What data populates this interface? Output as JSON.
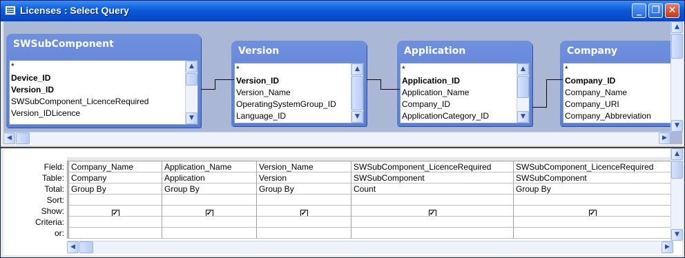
{
  "window": {
    "title": "Licenses : Select Query",
    "minimize": "_",
    "restore": "❐",
    "close": "✕"
  },
  "tables": [
    {
      "name": "SWSubComponent",
      "fields": [
        {
          "label": "*",
          "key": false
        },
        {
          "label": "Device_ID",
          "key": true
        },
        {
          "label": "Version_ID",
          "key": true
        },
        {
          "label": "SWSubComponent_LicenceRequired",
          "key": false
        },
        {
          "label": "Version_IDLicence",
          "key": false
        }
      ]
    },
    {
      "name": "Version",
      "fields": [
        {
          "label": "*",
          "key": false
        },
        {
          "label": "Version_ID",
          "key": true
        },
        {
          "label": "Version_Name",
          "key": false
        },
        {
          "label": "OperatingSystemGroup_ID",
          "key": false
        },
        {
          "label": "Language_ID",
          "key": false
        }
      ]
    },
    {
      "name": "Application",
      "fields": [
        {
          "label": "*",
          "key": false
        },
        {
          "label": "Application_ID",
          "key": true
        },
        {
          "label": "Application_Name",
          "key": false
        },
        {
          "label": "Company_ID",
          "key": false
        },
        {
          "label": "ApplicationCategory_ID",
          "key": false
        }
      ]
    },
    {
      "name": "Company",
      "fields": [
        {
          "label": "*",
          "key": false
        },
        {
          "label": "Company_ID",
          "key": true
        },
        {
          "label": "Company_Name",
          "key": false
        },
        {
          "label": "Company_URI",
          "key": false
        },
        {
          "label": "Company_Abbreviation",
          "key": false
        }
      ]
    }
  ],
  "grid": {
    "row_labels": [
      "Field:",
      "Table:",
      "Total:",
      "Sort:",
      "Show:",
      "Criteria:",
      "or:"
    ],
    "columns": [
      {
        "field": "Company_Name",
        "table": "Company",
        "total": "Group By",
        "sort": "",
        "show": true
      },
      {
        "field": "Application_Name",
        "table": "Application",
        "total": "Group By",
        "sort": "",
        "show": true
      },
      {
        "field": "Version_Name",
        "table": "Version",
        "total": "Group By",
        "sort": "",
        "show": true
      },
      {
        "field": "SWSubComponent_LicenceRequired",
        "table": "SWSubComponent",
        "total": "Count",
        "sort": "",
        "show": true
      },
      {
        "field": "SWSubComponent_LicenceRequired",
        "table": "SWSubComponent",
        "total": "Group By",
        "sort": "",
        "show": true
      }
    ],
    "check_glyph": "✓"
  },
  "scroll": {
    "up": "▲",
    "down": "▼",
    "left": "◀",
    "right": "▶"
  }
}
